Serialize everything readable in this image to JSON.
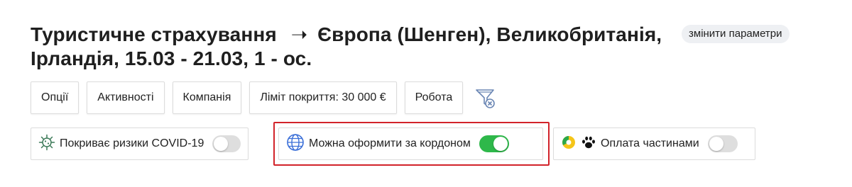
{
  "header": {
    "title_part1": "Туристичне страхування",
    "arrow": "➝",
    "title_part2": "Європа (Шенген), Великобританія, Ірландія, 15.03 - 21.03, 1 - ос.",
    "change_label": "змінити параметри"
  },
  "filters": [
    {
      "label": "Опції"
    },
    {
      "label": "Активності"
    },
    {
      "label": "Компанія"
    },
    {
      "label": "Ліміт покриття: 30 000 €"
    },
    {
      "label": "Робота"
    }
  ],
  "toggles": [
    {
      "label": "Покриває ризики COVID-19",
      "icon": "virus-icon",
      "state": "off"
    },
    {
      "label": "Можна оформити за кордоном",
      "icon": "globe-icon",
      "state": "on"
    },
    {
      "label": "Оплата частинами",
      "icon": "paw-icon",
      "state": "off"
    }
  ],
  "colors": {
    "toggle_on": "#2eb84a",
    "toggle_off": "#dedede",
    "highlight": "#d2232a",
    "globe": "#3b6fd8"
  }
}
